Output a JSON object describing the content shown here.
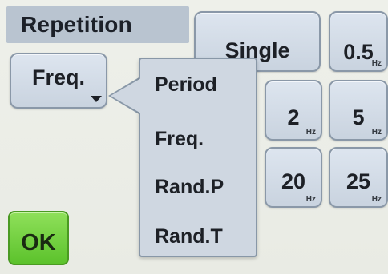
{
  "title": "Repetition",
  "mode_dropdown": {
    "label": "Freq."
  },
  "menu": {
    "items": [
      {
        "label": "Period"
      },
      {
        "label": "Freq."
      },
      {
        "label": "Rand.P"
      },
      {
        "label": "Rand.T"
      }
    ]
  },
  "buttons": {
    "single": "Single",
    "values": [
      {
        "value": "0.5",
        "unit": "Hz"
      },
      {
        "value": "2",
        "unit": "Hz"
      },
      {
        "value": "5",
        "unit": "Hz"
      },
      {
        "value": "20",
        "unit": "Hz"
      },
      {
        "value": "25",
        "unit": "Hz"
      }
    ]
  },
  "ok_label": "OK",
  "colors": {
    "background": "#eef0ea",
    "title_bar": "#b9c4d0",
    "button": "#dde5ef",
    "menu": "#cfd7e1",
    "ok_button": "#6ccf35"
  }
}
